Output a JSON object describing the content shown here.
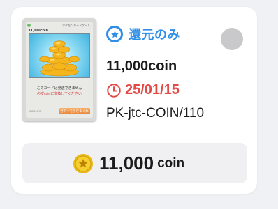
{
  "card_thumbnail": {
    "name": "11,000coin",
    "game_label": "ポケモンカードゲーム",
    "notice_line1": "このカードは発送できません",
    "notice_line2": "必ずcoinに交換してください",
    "id_label": "COIN-PC",
    "button_label": "ガチャを引きまくれ!"
  },
  "badge": {
    "label": "還元のみ",
    "color": "#2f8fe6"
  },
  "item": {
    "price": "11,000coin",
    "date": "25/01/15",
    "date_color": "#e24b45",
    "code": "PK-jtc-COIN/110"
  },
  "total": {
    "amount": "11,000",
    "unit": "coin"
  }
}
